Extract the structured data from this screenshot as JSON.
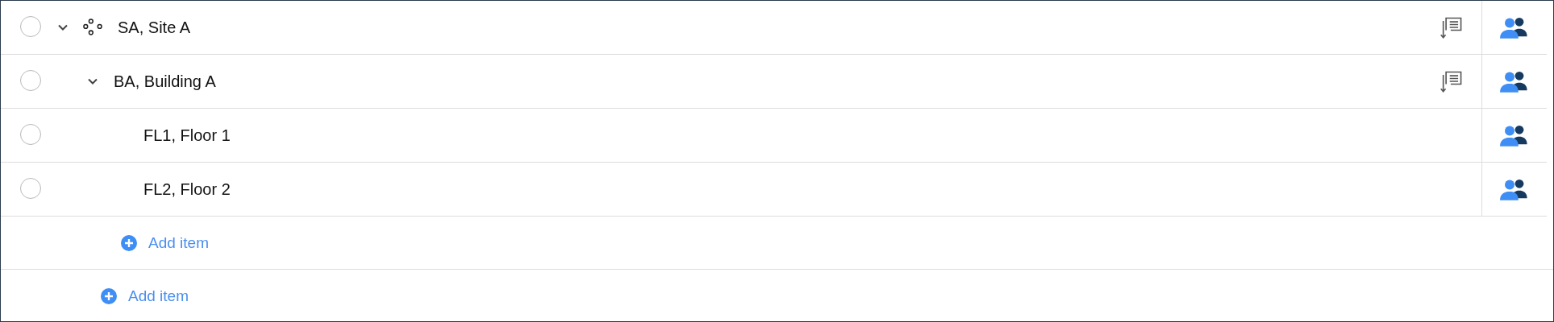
{
  "tree": [
    {
      "kind": "site",
      "label": "SA, Site A",
      "selected": false,
      "expanded": true,
      "has_report": true,
      "add_label": "Add item",
      "children": [
        {
          "label": "BA, Building A",
          "selected": false,
          "expanded": true,
          "has_report": true,
          "add_label": "Add item",
          "children": [
            {
              "label": "FL1, Floor 1",
              "selected": false,
              "has_report": false
            },
            {
              "label": "FL2, Floor 2",
              "selected": false,
              "has_report": false
            }
          ]
        }
      ]
    }
  ]
}
